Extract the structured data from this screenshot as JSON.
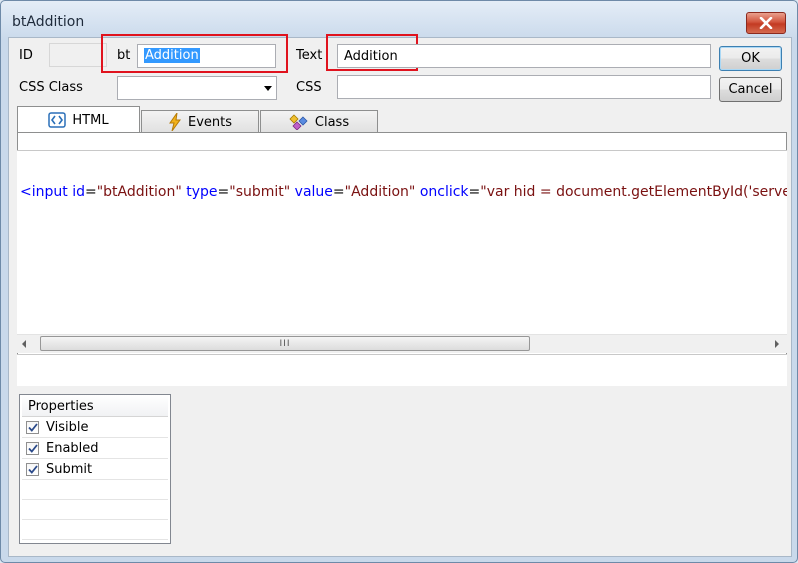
{
  "window": {
    "title": "btAddition"
  },
  "form": {
    "id_label": "ID",
    "id_prefix": "bt",
    "id_value": "Addition",
    "text_label": "Text",
    "text_value": "Addition",
    "css_class_label": "CSS Class",
    "css_label": "CSS",
    "css_class_value": "",
    "css_value": ""
  },
  "buttons": {
    "ok": "OK",
    "cancel": "Cancel"
  },
  "tabs": [
    {
      "label": "HTML",
      "icon": "html-icon",
      "active": true
    },
    {
      "label": "Events",
      "icon": "lightning-icon",
      "active": false
    },
    {
      "label": "Class",
      "icon": "class-icon",
      "active": false
    }
  ],
  "code": {
    "open": "<",
    "tag": "input",
    "a1": "id",
    "v1": "\"btAddition\"",
    "a2": "type",
    "v2": "\"submit\"",
    "a3": "value",
    "v3": "\"Addition\"",
    "a4": "onclick",
    "v4": "\"var hid = document.getElementById('serve",
    "eq": "="
  },
  "scrollbar": {
    "thumb_grip": "III"
  },
  "properties": {
    "header": "Properties",
    "items": [
      {
        "label": "Visible",
        "checked": true
      },
      {
        "label": "Enabled",
        "checked": true
      },
      {
        "label": "Submit",
        "checked": true
      }
    ]
  },
  "colors": {
    "highlight": "#e0131e",
    "selection": "#3399ff"
  }
}
